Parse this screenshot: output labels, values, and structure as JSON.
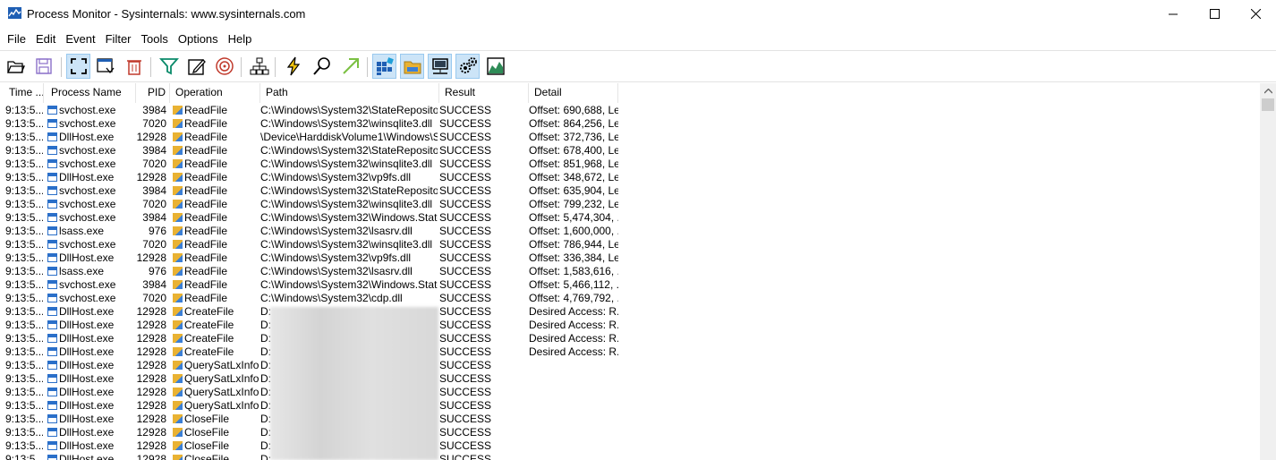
{
  "window": {
    "title": "Process Monitor - Sysinternals: www.sysinternals.com",
    "minimize": "—",
    "maximize": "☐",
    "close": "✕"
  },
  "menu": [
    "File",
    "Edit",
    "Event",
    "Filter",
    "Tools",
    "Options",
    "Help"
  ],
  "toolbar": [
    {
      "name": "open-icon",
      "pressed": false
    },
    {
      "name": "save-icon",
      "pressed": false
    },
    {
      "name": "capture-icon",
      "pressed": true
    },
    {
      "name": "autoscroll-icon",
      "pressed": false
    },
    {
      "name": "clear-icon",
      "pressed": false
    },
    {
      "name": "filter-icon",
      "pressed": false
    },
    {
      "name": "highlight-icon",
      "pressed": false
    },
    {
      "name": "target-icon",
      "pressed": false
    },
    {
      "name": "process-tree-icon",
      "pressed": false
    },
    {
      "name": "event-properties-icon",
      "pressed": false
    },
    {
      "name": "find-icon",
      "pressed": false
    },
    {
      "name": "jump-icon",
      "pressed": false
    },
    {
      "name": "registry-activity-icon",
      "pressed": true
    },
    {
      "name": "filesystem-activity-icon",
      "pressed": true
    },
    {
      "name": "network-activity-icon",
      "pressed": true
    },
    {
      "name": "process-activity-icon",
      "pressed": true
    },
    {
      "name": "profiling-icon",
      "pressed": false
    }
  ],
  "columns": {
    "time": "Time ...",
    "process": "Process Name",
    "pid": "PID",
    "operation": "Operation",
    "path": "Path",
    "result": "Result",
    "detail": "Detail"
  },
  "rows": [
    {
      "time": "9:13:5...",
      "process": "svchost.exe",
      "pid": "3984",
      "op": "ReadFile",
      "path": "C:\\Windows\\System32\\StateRepository...",
      "result": "SUCCESS",
      "detail": "Offset: 690,688, Le..."
    },
    {
      "time": "9:13:5...",
      "process": "svchost.exe",
      "pid": "7020",
      "op": "ReadFile",
      "path": "C:\\Windows\\System32\\winsqlite3.dll",
      "result": "SUCCESS",
      "detail": "Offset: 864,256, Le..."
    },
    {
      "time": "9:13:5...",
      "process": "DllHost.exe",
      "pid": "12928",
      "op": "ReadFile",
      "path": "\\Device\\HarddiskVolume1\\Windows\\S...",
      "result": "SUCCESS",
      "detail": "Offset: 372,736, Le..."
    },
    {
      "time": "9:13:5...",
      "process": "svchost.exe",
      "pid": "3984",
      "op": "ReadFile",
      "path": "C:\\Windows\\System32\\StateRepository...",
      "result": "SUCCESS",
      "detail": "Offset: 678,400, Le..."
    },
    {
      "time": "9:13:5...",
      "process": "svchost.exe",
      "pid": "7020",
      "op": "ReadFile",
      "path": "C:\\Windows\\System32\\winsqlite3.dll",
      "result": "SUCCESS",
      "detail": "Offset: 851,968, Le..."
    },
    {
      "time": "9:13:5...",
      "process": "DllHost.exe",
      "pid": "12928",
      "op": "ReadFile",
      "path": "C:\\Windows\\System32\\vp9fs.dll",
      "result": "SUCCESS",
      "detail": "Offset: 348,672, Le..."
    },
    {
      "time": "9:13:5...",
      "process": "svchost.exe",
      "pid": "3984",
      "op": "ReadFile",
      "path": "C:\\Windows\\System32\\StateRepository...",
      "result": "SUCCESS",
      "detail": "Offset: 635,904, Le..."
    },
    {
      "time": "9:13:5...",
      "process": "svchost.exe",
      "pid": "7020",
      "op": "ReadFile",
      "path": "C:\\Windows\\System32\\winsqlite3.dll",
      "result": "SUCCESS",
      "detail": "Offset: 799,232, Le..."
    },
    {
      "time": "9:13:5...",
      "process": "svchost.exe",
      "pid": "3984",
      "op": "ReadFile",
      "path": "C:\\Windows\\System32\\Windows.State...",
      "result": "SUCCESS",
      "detail": "Offset: 5,474,304, ..."
    },
    {
      "time": "9:13:5...",
      "process": "lsass.exe",
      "pid": "976",
      "op": "ReadFile",
      "path": "C:\\Windows\\System32\\lsasrv.dll",
      "result": "SUCCESS",
      "detail": "Offset: 1,600,000, ..."
    },
    {
      "time": "9:13:5...",
      "process": "svchost.exe",
      "pid": "7020",
      "op": "ReadFile",
      "path": "C:\\Windows\\System32\\winsqlite3.dll",
      "result": "SUCCESS",
      "detail": "Offset: 786,944, Le..."
    },
    {
      "time": "9:13:5...",
      "process": "DllHost.exe",
      "pid": "12928",
      "op": "ReadFile",
      "path": "C:\\Windows\\System32\\vp9fs.dll",
      "result": "SUCCESS",
      "detail": "Offset: 336,384, Le..."
    },
    {
      "time": "9:13:5...",
      "process": "lsass.exe",
      "pid": "976",
      "op": "ReadFile",
      "path": "C:\\Windows\\System32\\lsasrv.dll",
      "result": "SUCCESS",
      "detail": "Offset: 1,583,616, ..."
    },
    {
      "time": "9:13:5...",
      "process": "svchost.exe",
      "pid": "3984",
      "op": "ReadFile",
      "path": "C:\\Windows\\System32\\Windows.State...",
      "result": "SUCCESS",
      "detail": "Offset: 5,466,112, ..."
    },
    {
      "time": "9:13:5...",
      "process": "svchost.exe",
      "pid": "7020",
      "op": "ReadFile",
      "path": "C:\\Windows\\System32\\cdp.dll",
      "result": "SUCCESS",
      "detail": "Offset: 4,769,792, ..."
    },
    {
      "time": "9:13:5...",
      "process": "DllHost.exe",
      "pid": "12928",
      "op": "CreateFile",
      "path": "D:",
      "result": "SUCCESS",
      "detail": "Desired Access: R..."
    },
    {
      "time": "9:13:5...",
      "process": "DllHost.exe",
      "pid": "12928",
      "op": "CreateFile",
      "path": "D:",
      "result": "SUCCESS",
      "detail": "Desired Access: R..."
    },
    {
      "time": "9:13:5...",
      "process": "DllHost.exe",
      "pid": "12928",
      "op": "CreateFile",
      "path": "D:",
      "result": "SUCCESS",
      "detail": "Desired Access: R..."
    },
    {
      "time": "9:13:5...",
      "process": "DllHost.exe",
      "pid": "12928",
      "op": "CreateFile",
      "path": "D:",
      "result": "SUCCESS",
      "detail": "Desired Access: R..."
    },
    {
      "time": "9:13:5...",
      "process": "DllHost.exe",
      "pid": "12928",
      "op": "QuerySatLxInfo...",
      "path": "D:",
      "result": "SUCCESS",
      "detail": ""
    },
    {
      "time": "9:13:5...",
      "process": "DllHost.exe",
      "pid": "12928",
      "op": "QuerySatLxInfo...",
      "path": "D:",
      "result": "SUCCESS",
      "detail": ""
    },
    {
      "time": "9:13:5...",
      "process": "DllHost.exe",
      "pid": "12928",
      "op": "QuerySatLxInfo...",
      "path": "D:",
      "result": "SUCCESS",
      "detail": ""
    },
    {
      "time": "9:13:5...",
      "process": "DllHost.exe",
      "pid": "12928",
      "op": "QuerySatLxInfo...",
      "path": "D:",
      "result": "SUCCESS",
      "detail": ""
    },
    {
      "time": "9:13:5...",
      "process": "DllHost.exe",
      "pid": "12928",
      "op": "CloseFile",
      "path": "D:",
      "result": "SUCCESS",
      "detail": ""
    },
    {
      "time": "9:13:5...",
      "process": "DllHost.exe",
      "pid": "12928",
      "op": "CloseFile",
      "path": "D:",
      "result": "SUCCESS",
      "detail": ""
    },
    {
      "time": "9:13:5...",
      "process": "DllHost.exe",
      "pid": "12928",
      "op": "CloseFile",
      "path": "D:",
      "result": "SUCCESS",
      "detail": ""
    },
    {
      "time": "9:13:5...",
      "process": "DllHost.exe",
      "pid": "12928",
      "op": "CloseFile",
      "path": "D:",
      "result": "SUCCESS",
      "detail": ""
    }
  ]
}
